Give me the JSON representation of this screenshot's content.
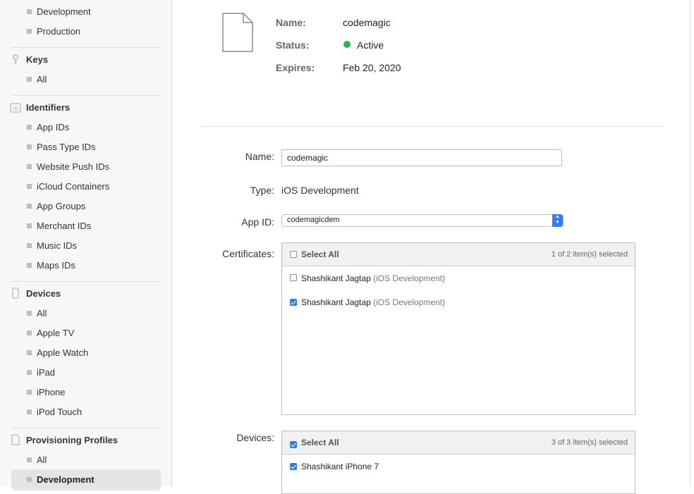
{
  "sidebar": {
    "certificates_items": [
      "Development",
      "Production"
    ],
    "keys": {
      "title": "Keys",
      "items": [
        "All"
      ]
    },
    "identifiers": {
      "title": "Identifiers",
      "items": [
        "App IDs",
        "Pass Type IDs",
        "Website Push IDs",
        "iCloud Containers",
        "App Groups",
        "Merchant IDs",
        "Music IDs",
        "Maps IDs"
      ]
    },
    "devices": {
      "title": "Devices",
      "items": [
        "All",
        "Apple TV",
        "Apple Watch",
        "iPad",
        "iPhone",
        "iPod Touch"
      ]
    },
    "profiles": {
      "title": "Provisioning Profiles",
      "items": [
        "All",
        "Development"
      ],
      "active": "Development"
    },
    "id_icon_text": "ID"
  },
  "summary": {
    "name_label": "Name:",
    "name_value": "codemagic",
    "status_label": "Status:",
    "status_value": "Active",
    "status_color": "#27b44b",
    "expires_label": "Expires:",
    "expires_value": "Feb 20, 2020"
  },
  "form": {
    "name_label": "Name:",
    "name_value": "codemagic",
    "type_label": "Type:",
    "type_value": "iOS Development",
    "appid_label": "App ID:",
    "appid_value": "codemagicdem",
    "certificates": {
      "label": "Certificates:",
      "select_all": "Select All",
      "count": "1 of 2 item(s) selected",
      "rows": [
        {
          "name": "Shashikant Jagtap",
          "type": "(iOS Development)",
          "checked": false
        },
        {
          "name": "Shashikant Jagtap",
          "type": "(iOS Development)",
          "checked": true
        }
      ]
    },
    "devices": {
      "label": "Devices:",
      "select_all": "Select All",
      "count": "3 of 3 item(s) selected",
      "rows": [
        {
          "name": "Shashikant iPhone 7",
          "checked": true
        }
      ]
    }
  },
  "colors": {
    "accent": "#2f7cf6",
    "active_green": "#27b44b"
  }
}
